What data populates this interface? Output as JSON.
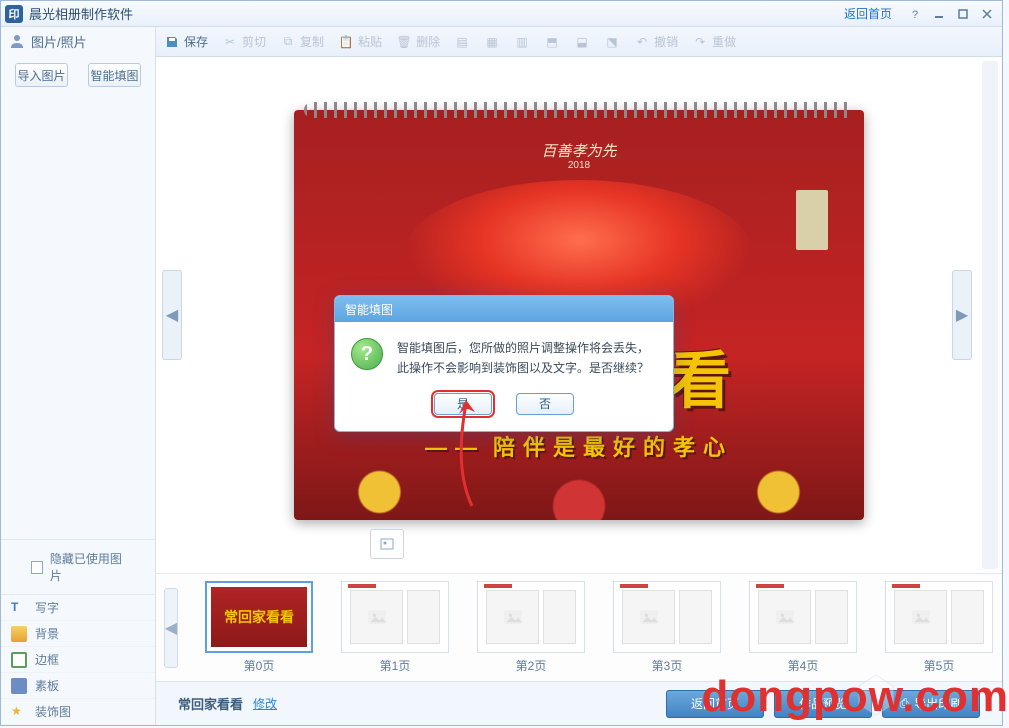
{
  "app": {
    "title": "晨光相册制作软件",
    "icon_letter": "印"
  },
  "titlebar": {
    "home_link": "返回首页"
  },
  "sidebar": {
    "photos_label": "图片/照片",
    "import_button": "导入图片",
    "smartfill_button": "智能填图",
    "hide_used_label": "隐藏已使用图片",
    "tools": {
      "text": "写字",
      "background": "背景",
      "border": "边框",
      "template": "素板",
      "decoration": "装饰图"
    }
  },
  "toolbar": {
    "save": "保存",
    "cut": "剪切",
    "copy": "复制",
    "paste": "粘贴",
    "delete": "删除",
    "align1": "",
    "align2": "",
    "align3": "",
    "align4": "",
    "align5": "",
    "align6": "",
    "undo": "撤销",
    "redo": "重做"
  },
  "canvas": {
    "top_script": "百善孝为先",
    "year": "2018",
    "main_title": "常回家看看",
    "subtitle_dash": "——",
    "subtitle": "陪伴是最好的孝心"
  },
  "thumbs": [
    {
      "label": "第0页",
      "type": "cover",
      "cover_text": "常回家看看"
    },
    {
      "label": "第1页",
      "type": "placeholder"
    },
    {
      "label": "第2页",
      "type": "placeholder"
    },
    {
      "label": "第3页",
      "type": "placeholder"
    },
    {
      "label": "第4页",
      "type": "placeholder"
    },
    {
      "label": "第5页",
      "type": "placeholder"
    }
  ],
  "footer": {
    "project_name": "常回家看看",
    "modify": "修改",
    "back_home": "返回首页",
    "preview": "作品预览",
    "export_print": "导出印刷"
  },
  "dialog": {
    "title": "智能填图",
    "message": "智能填图后，您所做的照片调整操作将会丢失，此操作不会影响到装饰图以及文字。是否继续？",
    "yes": "是",
    "no": "否"
  },
  "watermark": "dongpow.com"
}
